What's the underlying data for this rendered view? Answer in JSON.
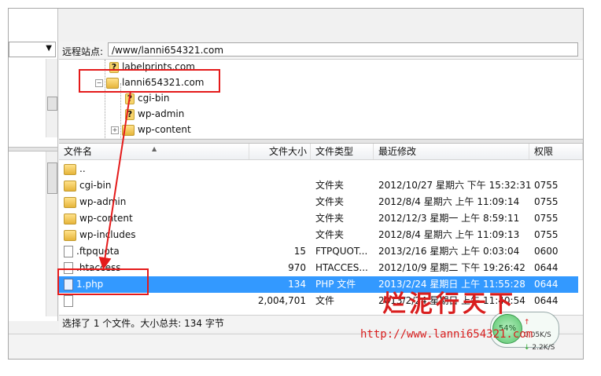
{
  "remote": {
    "site_label": "远程站点:",
    "site_path": "/www/lanni654321.com"
  },
  "tree": [
    {
      "label": "labelprints.com",
      "icon": "question-folder-icon"
    },
    {
      "label": "lanni654321.com",
      "icon": "folder-icon"
    },
    {
      "label": "cgi-bin",
      "icon": "question-folder-icon"
    },
    {
      "label": "wp-admin",
      "icon": "question-folder-icon"
    },
    {
      "label": "wp-content",
      "icon": "folder-icon"
    }
  ],
  "columns": {
    "name": "文件名",
    "size": "文件大小",
    "type": "文件类型",
    "modified": "最近修改",
    "perm": "权限"
  },
  "files": [
    {
      "name": "..",
      "size": "",
      "type": "",
      "modified": "",
      "perm": "",
      "icon": "folder-icon"
    },
    {
      "name": "cgi-bin",
      "size": "",
      "type": "文件夹",
      "modified": "2012/10/27 星期六 下午 15:32:31",
      "perm": "0755",
      "icon": "folder-icon"
    },
    {
      "name": "wp-admin",
      "size": "",
      "type": "文件夹",
      "modified": "2012/8/4 星期六 上午 11:09:14",
      "perm": "0755",
      "icon": "folder-icon"
    },
    {
      "name": "wp-content",
      "size": "",
      "type": "文件夹",
      "modified": "2012/12/3 星期一 上午 8:59:11",
      "perm": "0755",
      "icon": "folder-icon"
    },
    {
      "name": "wp-includes",
      "size": "",
      "type": "文件夹",
      "modified": "2012/8/4 星期六 上午 11:09:13",
      "perm": "0755",
      "icon": "folder-icon"
    },
    {
      "name": ".ftpquota",
      "size": "15",
      "type": "FTPQUOT...",
      "modified": "2013/2/16 星期六 上午 0:03:04",
      "perm": "0600",
      "icon": "file-icon"
    },
    {
      "name": ".htaccess",
      "size": "970",
      "type": "HTACCES...",
      "modified": "2012/10/9 星期二 下午 19:26:42",
      "perm": "0644",
      "icon": "file-icon"
    },
    {
      "name": "1.php",
      "size": "134",
      "type": "PHP 文件",
      "modified": "2013/2/24 星期日 上午 11:55:28",
      "perm": "0644",
      "icon": "php-file-icon",
      "selected": true
    },
    {
      "name": "",
      "size": "2,004,701",
      "type": "文件",
      "modified": "2013/2/24 星期日 上午 11:40:54",
      "perm": "0644",
      "icon": "file-icon"
    }
  ],
  "status_text": "选择了 1 个文件。大小总共: 134 字节",
  "speed": {
    "percent": "54%",
    "upload": "0.05K/S",
    "download": "2.2K/S"
  },
  "watermark": {
    "text": "烂泥行天下",
    "url": "http://www.lanni654321.com"
  },
  "colors": {
    "selection": "#3399ff",
    "annotation": "#e41a1a"
  }
}
